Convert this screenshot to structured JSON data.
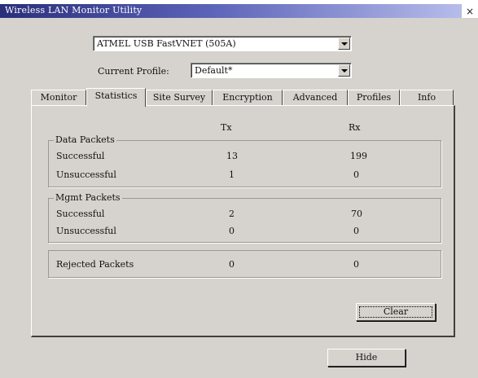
{
  "window": {
    "title": "Wireless LAN Monitor Utility",
    "close_glyph": "×"
  },
  "device": {
    "selected": "ATMEL USB FastVNET (505A)"
  },
  "profile": {
    "label": "Current Profile:",
    "selected": "Default*"
  },
  "tabs": [
    {
      "label": "Monitor"
    },
    {
      "label": "Statistics",
      "active": true
    },
    {
      "label": "Site Survey"
    },
    {
      "label": "Encryption"
    },
    {
      "label": "Advanced"
    },
    {
      "label": "Profiles"
    },
    {
      "label": "Info"
    }
  ],
  "stats": {
    "tx_header": "Tx",
    "rx_header": "Rx",
    "data_packets": {
      "title": "Data Packets",
      "rows": [
        {
          "label": "Successful",
          "tx": "13",
          "rx": "199"
        },
        {
          "label": "Unsuccessful",
          "tx": "1",
          "rx": "0"
        }
      ]
    },
    "mgmt_packets": {
      "title": "Mgmt Packets",
      "rows": [
        {
          "label": "Successful",
          "tx": "2",
          "rx": "70"
        },
        {
          "label": "Unsuccessful",
          "tx": "0",
          "rx": "0"
        }
      ]
    },
    "rejected": {
      "label": "Rejected Packets",
      "tx": "0",
      "rx": "0"
    }
  },
  "buttons": {
    "clear": "Clear",
    "hide": "Hide"
  }
}
